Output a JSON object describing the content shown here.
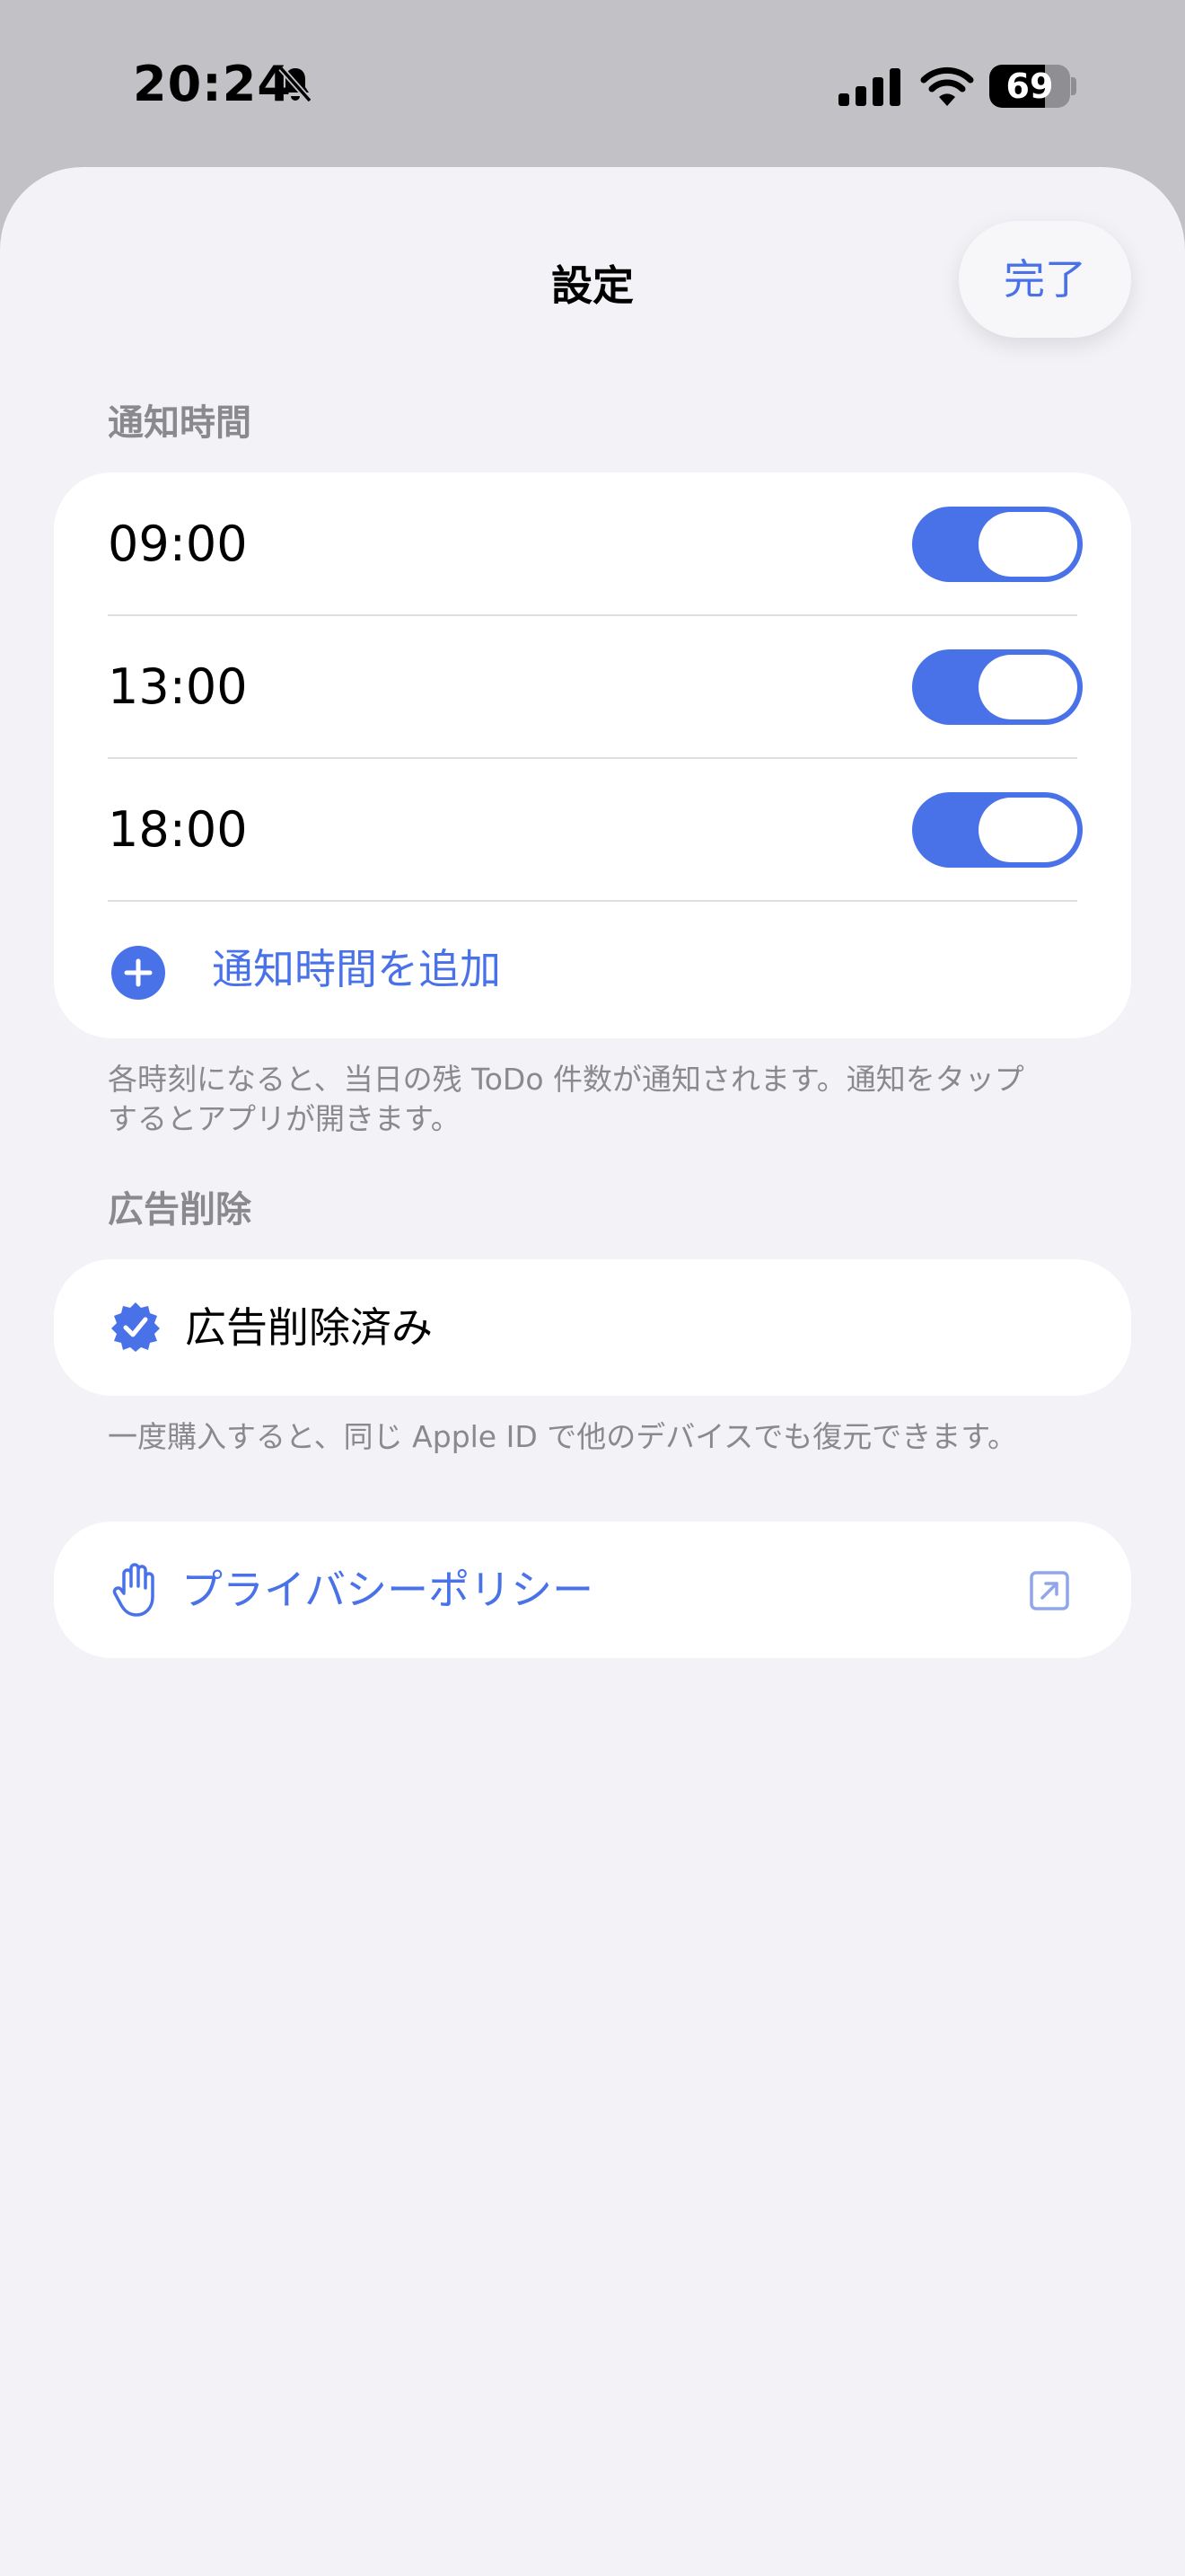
{
  "status_bar": {
    "time": "20:24",
    "battery_level": "69",
    "battery_fraction": 0.69,
    "icons": [
      "bell-slash-icon",
      "cellular-signal-icon",
      "wifi-icon",
      "battery-icon"
    ]
  },
  "nav": {
    "title": "設定",
    "done_label": "完了"
  },
  "notification_section": {
    "header": "通知時間",
    "times": [
      {
        "label": "09:00",
        "enabled": true
      },
      {
        "label": "13:00",
        "enabled": true
      },
      {
        "label": "18:00",
        "enabled": true
      }
    ],
    "add_label": "通知時間を追加",
    "add_icon": "plus-circle-icon",
    "footer_line1": "各時刻になると、当日の残 ToDo 件数が通知されます。通知をタップ",
    "footer_line2": "するとアプリが開きます。"
  },
  "ads_section": {
    "header": "広告削除",
    "status_label": "広告削除済み",
    "status_icon": "checkmark-seal-icon",
    "footer": "一度購入すると、同じ Apple ID で他のデバイスでも復元できます。"
  },
  "privacy": {
    "label": "プライバシーポリシー",
    "icon": "hand-raised-icon",
    "trailing_icon": "external-link-icon"
  },
  "colors": {
    "accent": "#4a72e8",
    "background": "#f2f2f7",
    "card": "#ffffff",
    "secondary_text": "#8a8a8e",
    "status_bar_bg": "#c2c1c6"
  }
}
